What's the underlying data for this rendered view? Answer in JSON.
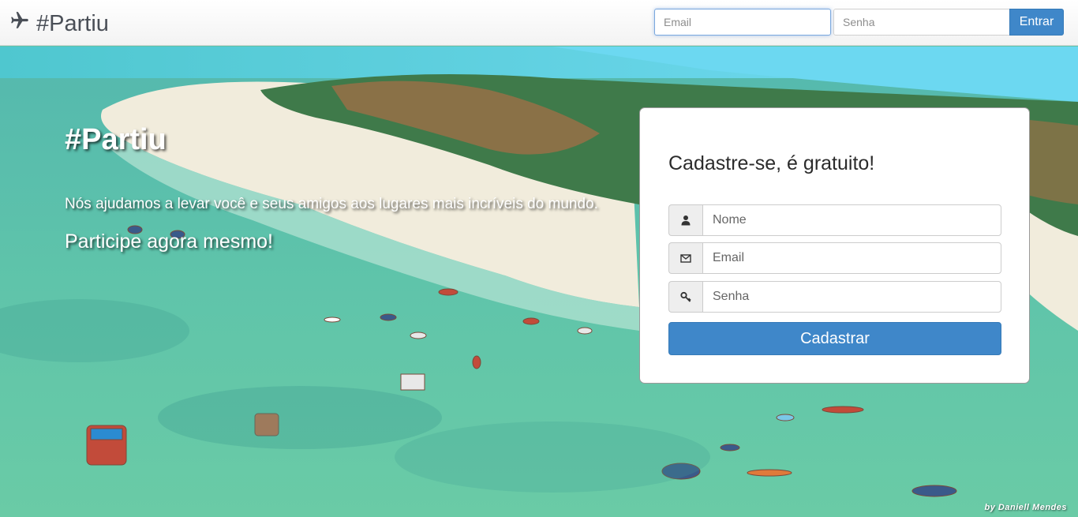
{
  "navbar": {
    "brand": "#Partiu",
    "brand_icon": "plane-icon",
    "email_placeholder": "Email",
    "password_placeholder": "Senha",
    "login_label": "Entrar"
  },
  "hero": {
    "title": "#Partiu",
    "lead": "Nós ajudamos a levar você e seus amigos aos lugares mais incríveis do mundo.",
    "cta": "Participe agora mesmo!",
    "credit": "by Daniell Mendes"
  },
  "signup": {
    "heading": "Cadastre-se, é gratuito!",
    "name_placeholder": "Nome",
    "name_icon": "user-icon",
    "email_placeholder": "Email",
    "email_icon": "envelope-icon",
    "password_placeholder": "Senha",
    "password_icon": "key-icon",
    "submit_label": "Cadastrar"
  },
  "colors": {
    "primary": "#3f87c9",
    "sea": "#5fc3a8",
    "sand": "#f1ecdc",
    "sky": "#6fd6f2"
  }
}
